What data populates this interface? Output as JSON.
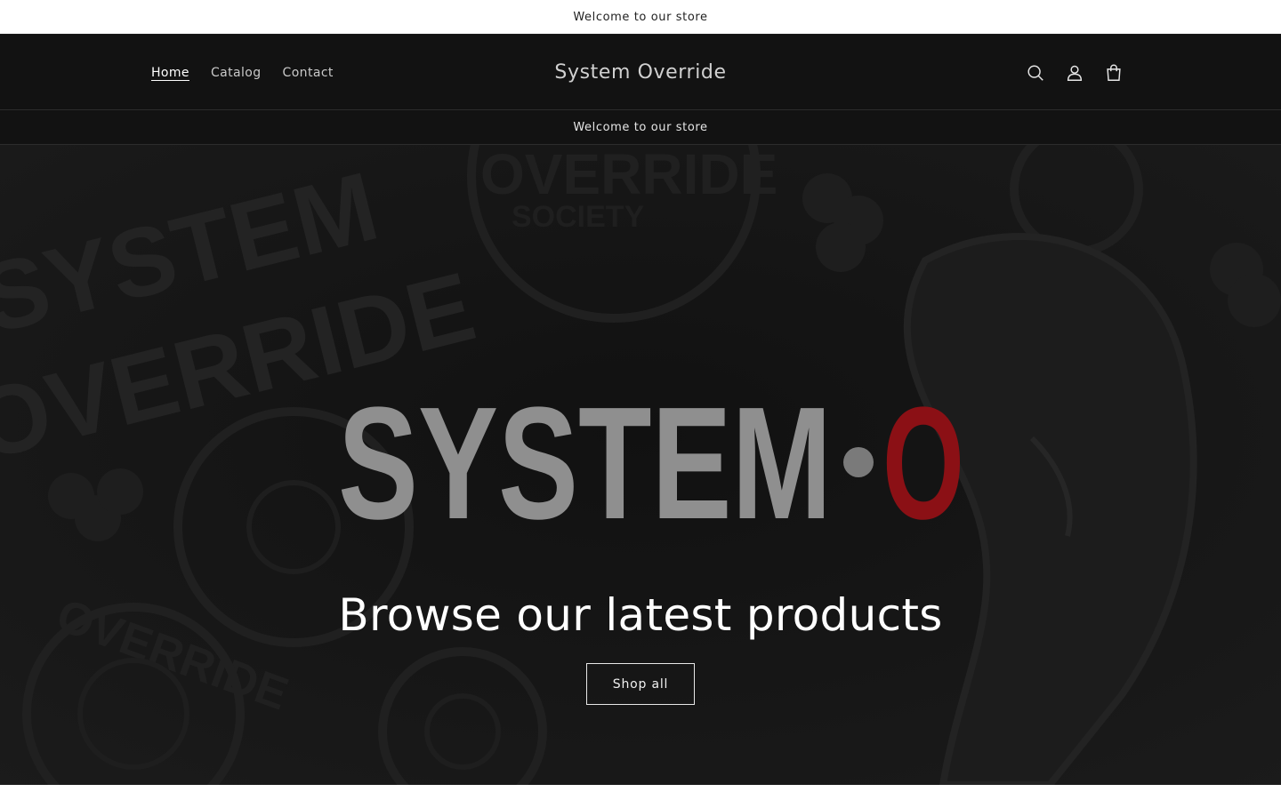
{
  "announcement_top": "Welcome to our store",
  "header": {
    "nav": [
      {
        "label": "Home",
        "active": true
      },
      {
        "label": "Catalog",
        "active": false
      },
      {
        "label": "Contact",
        "active": false
      }
    ],
    "store_name": "System Override",
    "icons": [
      "search-icon",
      "account-icon",
      "cart-icon"
    ]
  },
  "announcement_sub": "Welcome to our store",
  "hero": {
    "logo_word": "SYSTEM",
    "logo_letter": "O",
    "heading": "Browse our latest products",
    "button_label": "Shop all",
    "background_text": [
      "SYSTEM",
      "OVERRIDE",
      "OVERRIDE",
      "SOCIETY",
      "OVERRIDE"
    ]
  },
  "colors": {
    "header_bg": "#121212",
    "hero_bg": "#141414",
    "logo_grey": "#8f8f8f",
    "logo_red": "#8b1015"
  }
}
